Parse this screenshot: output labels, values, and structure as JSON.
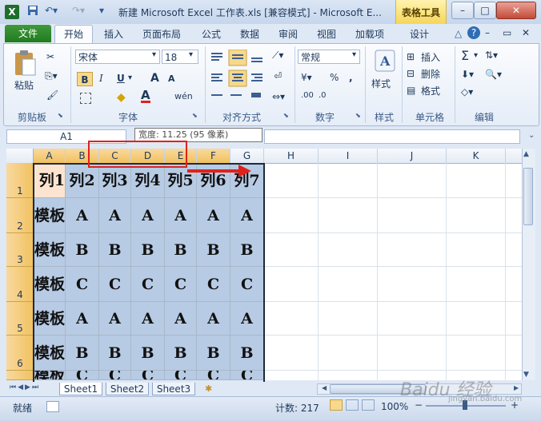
{
  "window": {
    "title": "新建 Microsoft Excel 工作表.xls  [兼容模式] - Microsoft E...",
    "contextual_tab": "表格工具",
    "minimize": "–",
    "maximize": "□",
    "close": "✕"
  },
  "tabs": [
    "文件",
    "开始",
    "插入",
    "页面布局",
    "公式",
    "数据",
    "审阅",
    "视图",
    "加载项",
    "设计"
  ],
  "ribbon": {
    "clipboard": {
      "paste": "粘贴",
      "label": "剪贴板"
    },
    "font": {
      "name": "宋体",
      "size": "18",
      "bold": "B",
      "italic": "I",
      "underline": "U",
      "grow": "A",
      "shrink": "A",
      "label": "字体",
      "wen": "wén"
    },
    "alignment": {
      "label": "对齐方式"
    },
    "number": {
      "format": "常规",
      "percent": "%",
      "comma": ",",
      "label": "数字"
    },
    "styles": {
      "label": "样式"
    },
    "cells": {
      "insert": "插入",
      "delete": "删除",
      "format": "格式",
      "label": "单元格"
    },
    "editing": {
      "label": "编辑",
      "sum": "Σ"
    }
  },
  "formula_bar": {
    "name_box": "A1",
    "tooltip": "宽度: 11.25 (95 像素)"
  },
  "columns": [
    "A",
    "B",
    "C",
    "D",
    "E",
    "F",
    "G",
    "H",
    "I",
    "J",
    "K"
  ],
  "rows": [
    "1",
    "2",
    "3",
    "4",
    "5",
    "6"
  ],
  "grid": [
    [
      "列1",
      "列2",
      "列3",
      "列4",
      "列5",
      "列6",
      "列7"
    ],
    [
      "模板",
      "A",
      "A",
      "A",
      "A",
      "A",
      "A"
    ],
    [
      "模板",
      "B",
      "B",
      "B",
      "B",
      "B",
      "B"
    ],
    [
      "模板",
      "C",
      "C",
      "C",
      "C",
      "C",
      "C"
    ],
    [
      "模板",
      "A",
      "A",
      "A",
      "A",
      "A",
      "A"
    ],
    [
      "模板",
      "B",
      "B",
      "B",
      "B",
      "B",
      "B"
    ],
    [
      "模板",
      "C",
      "C",
      "C",
      "C",
      "C",
      "C"
    ]
  ],
  "sheets": [
    "Sheet1",
    "Sheet2",
    "Sheet3"
  ],
  "status": {
    "ready": "就绪",
    "count": "计数: 217",
    "zoom": "100%",
    "zoom_minus": "−",
    "zoom_plus": "+"
  },
  "watermark": "Baidu 经验",
  "watermark_sub": "jingyan.baidu.com",
  "colors": {
    "selection": "#b7cbe4",
    "header_selected": "#f1c15f",
    "annotation": "#e0221b",
    "file_tab": "#217a1f"
  }
}
